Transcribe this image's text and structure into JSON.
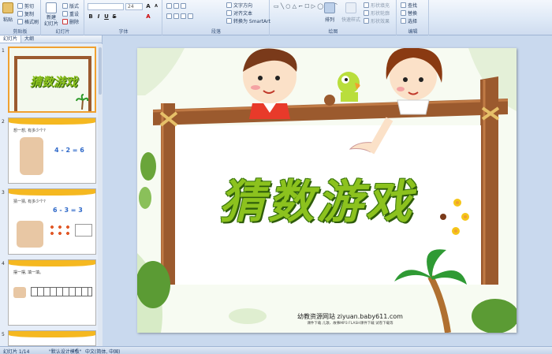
{
  "ribbon": {
    "clipboard": {
      "paste": "粘贴",
      "cut": "剪切",
      "copy": "复制",
      "format_painter": "格式刷",
      "label": "剪贴板"
    },
    "slides": {
      "new_slide": "新建",
      "new_slide_2": "幻灯片",
      "layout": "版式",
      "reset": "重设",
      "delete": "删除",
      "label": "幻灯片"
    },
    "font": {
      "font_size": "24",
      "label": "字体"
    },
    "paragraph": {
      "text_direction": "文字方向",
      "align_text": "对齐文本",
      "smartart": "转换为 SmartArt",
      "label": "段落"
    },
    "drawing": {
      "arrange": "排列",
      "quick_styles": "快速样式",
      "shape_fill": "形状填充",
      "shape_outline": "形状轮廓",
      "shape_effects": "形状效果",
      "label": "绘图"
    },
    "editing": {
      "find": "查找",
      "replace": "替换",
      "select": "选择",
      "label": "编辑"
    }
  },
  "panel": {
    "tab_slides": "幻灯片",
    "tab_outline": "大纲"
  },
  "thumbnails": [
    {
      "num": "1",
      "title": "猜数游戏"
    },
    {
      "num": "2",
      "line": "想一想, 有多少个?",
      "eq": "4 - 2 = 6"
    },
    {
      "num": "3",
      "line": "猜一猜, 有多少个?",
      "eq": "6 - 3 = 3"
    },
    {
      "num": "4",
      "line": "摆一摆, 填一填。"
    },
    {
      "num": "5"
    }
  ],
  "slide": {
    "title": "猜数游戏",
    "site": "幼教资源网站  ziyuan.baby611.com",
    "sub": "课件下载   儿歌、故事MP3   FLASH课件下载   试卷下载等"
  },
  "status": {
    "slide_count": "幻灯片 1/14",
    "theme": "\"默认设计模板\"",
    "language": "中文(简体, 中国)"
  },
  "colors": {
    "title_green": "#8cc21e",
    "frame_brown": "#9b5a2e",
    "selected_border": "#f0a030"
  }
}
